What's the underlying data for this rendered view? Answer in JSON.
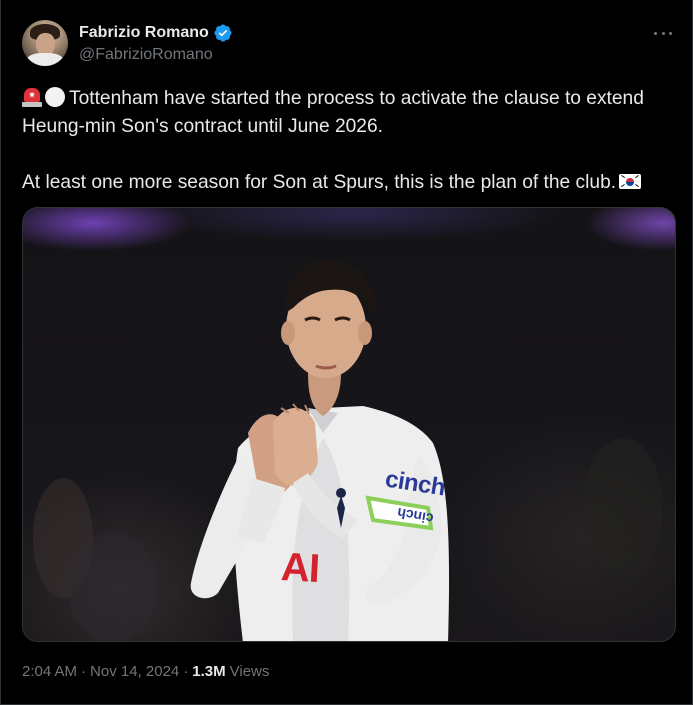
{
  "author": {
    "display_name": "Fabrizio Romano",
    "handle": "@FabrizioRomano",
    "verified": true,
    "avatar_icon": "avatar-photo"
  },
  "tweet": {
    "line1": "Tottenham have started the process to activate the clause to extend Heung-min Son's contract until June 2026.",
    "line2": "At least one more season for Son at Spurs, this is the plan of the club.",
    "leading_emojis": [
      "rotating-light-emoji",
      "white-circle-emoji"
    ],
    "trailing_emoji": "south-korea-flag-emoji"
  },
  "media": {
    "shirt_sponsor": "cinch",
    "shirt_front": "AI",
    "armband": "cinch"
  },
  "meta": {
    "time": "2:04 AM",
    "date": "Nov 14, 2024",
    "separator": "·",
    "views_count": "1.3M",
    "views_label": "Views"
  },
  "colors": {
    "background": "#000000",
    "text_primary": "#e7e9ea",
    "text_secondary": "#71767b",
    "verified_blue": "#1d9bf0",
    "border": "#2f3336"
  }
}
